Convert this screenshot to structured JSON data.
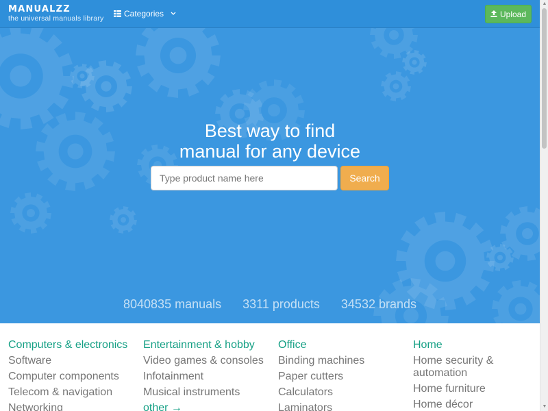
{
  "navbar": {
    "brand_title": "MANUALZZ",
    "brand_subtitle": "the universal manuals library",
    "categories_label": "Categories",
    "upload_label": "Upload"
  },
  "hero": {
    "title_line1": "Best way to find",
    "title_line2": "manual for any device",
    "search_placeholder": "Type product name here",
    "search_button": "Search",
    "stats": {
      "manuals": "8040835 manuals",
      "products": "3311 products",
      "brands": "34532 brands"
    }
  },
  "categories": [
    {
      "heading": "Computers & electronics",
      "items": [
        "Software",
        "Computer components",
        "Telecom & navigation",
        "Networking"
      ]
    },
    {
      "heading": "Entertainment & hobby",
      "items": [
        "Video games & consoles",
        "Infotainment",
        "Musical instruments"
      ],
      "other": "other →"
    },
    {
      "heading": "Office",
      "items": [
        "Binding machines",
        "Paper cutters",
        "Calculators",
        "Laminators"
      ]
    },
    {
      "heading": "Home",
      "items": [
        "Home security & automation",
        "Home furniture",
        "Home décor"
      ]
    }
  ],
  "colors": {
    "navbar": "#2f8fda",
    "hero": "#3b97e0",
    "upload": "#5cb85c",
    "search": "#f0ad4e",
    "category_heading": "#16a085",
    "category_item": "#777777"
  },
  "icons": {
    "categories": "list-icon",
    "chevron": "chevron-down-icon",
    "upload": "upload-icon"
  }
}
